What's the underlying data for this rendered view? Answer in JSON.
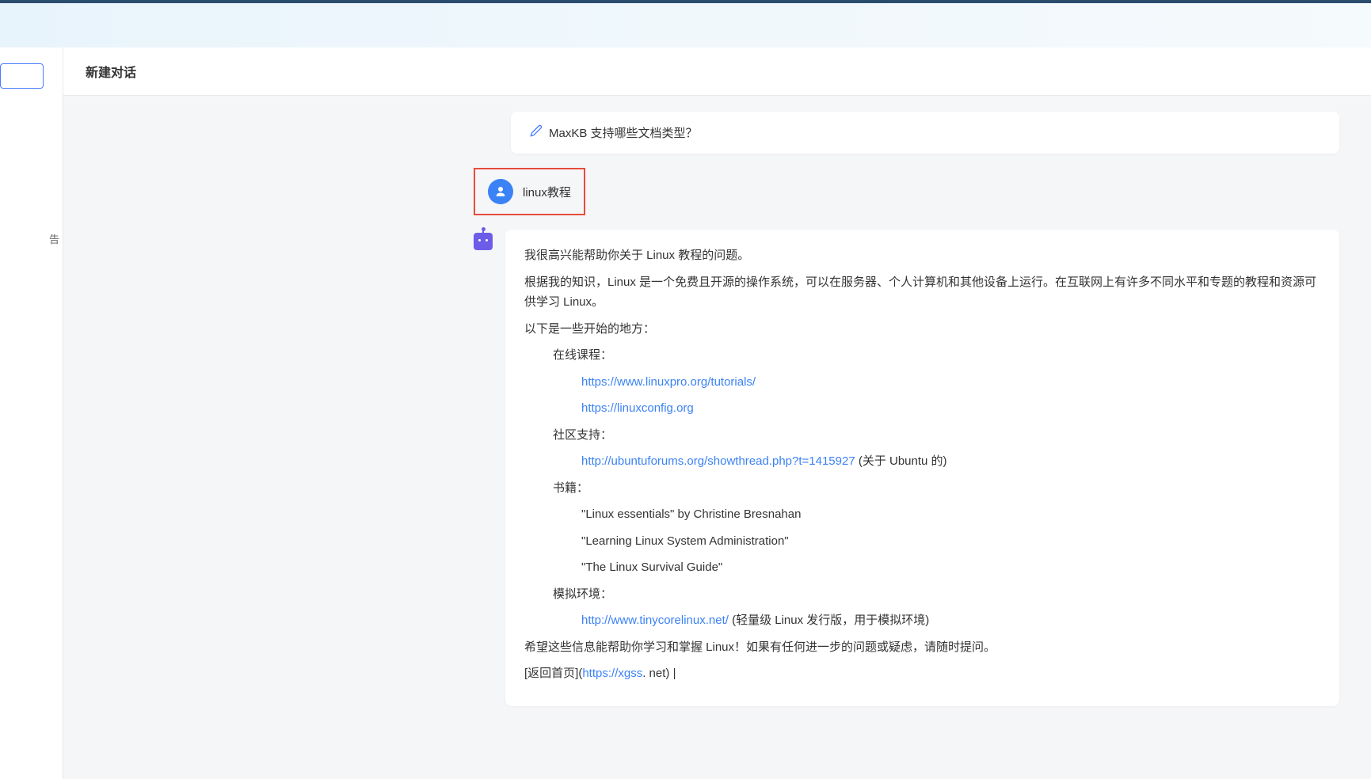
{
  "header": {
    "title": "新建对话"
  },
  "sidebar": {
    "truncated_label": "告"
  },
  "suggestion": {
    "text": "MaxKB 支持哪些文档类型？"
  },
  "user_message": {
    "text": "linux教程"
  },
  "bot_message": {
    "intro_line1": "我很高兴能帮助你关于 Linux 教程的问题。",
    "intro_line2": "根据我的知识，Linux 是一个免费且开源的操作系统，可以在服务器、个人计算机和其他设备上运行。在互联网上有许多不同水平和专题的教程和资源可供学习 Linux。",
    "start_places": "以下是一些开始的地方：",
    "section_online": "在线课程：",
    "link_linuxpro": "https://www.linuxpro.org/tutorials/",
    "link_linuxconfig": "https://linuxconfig.org",
    "section_community": "社区支持：",
    "link_ubuntuforums": "http://ubuntuforums.org/showthread.php?t=1415927",
    "ubuntu_note": " (关于 Ubuntu 的)",
    "section_books": "书籍：",
    "book1": "\"Linux essentials\" by Christine Bresnahan",
    "book2": "\"Learning Linux System Administration\"",
    "book3": "\"The Linux Survival Guide\"",
    "section_sim": "模拟环境：",
    "link_tinycore": "http://www.tinycorelinux.net/",
    "tinycore_note": " (轻量级 Linux 发行版，用于模拟环境)",
    "outro": "希望这些信息能帮助你学习和掌握 Linux！如果有任何进一步的问题或疑虑，请随时提问。",
    "return_prefix": "[返回首页](",
    "return_link": "https://xgss",
    "return_suffix": ". net) |"
  }
}
